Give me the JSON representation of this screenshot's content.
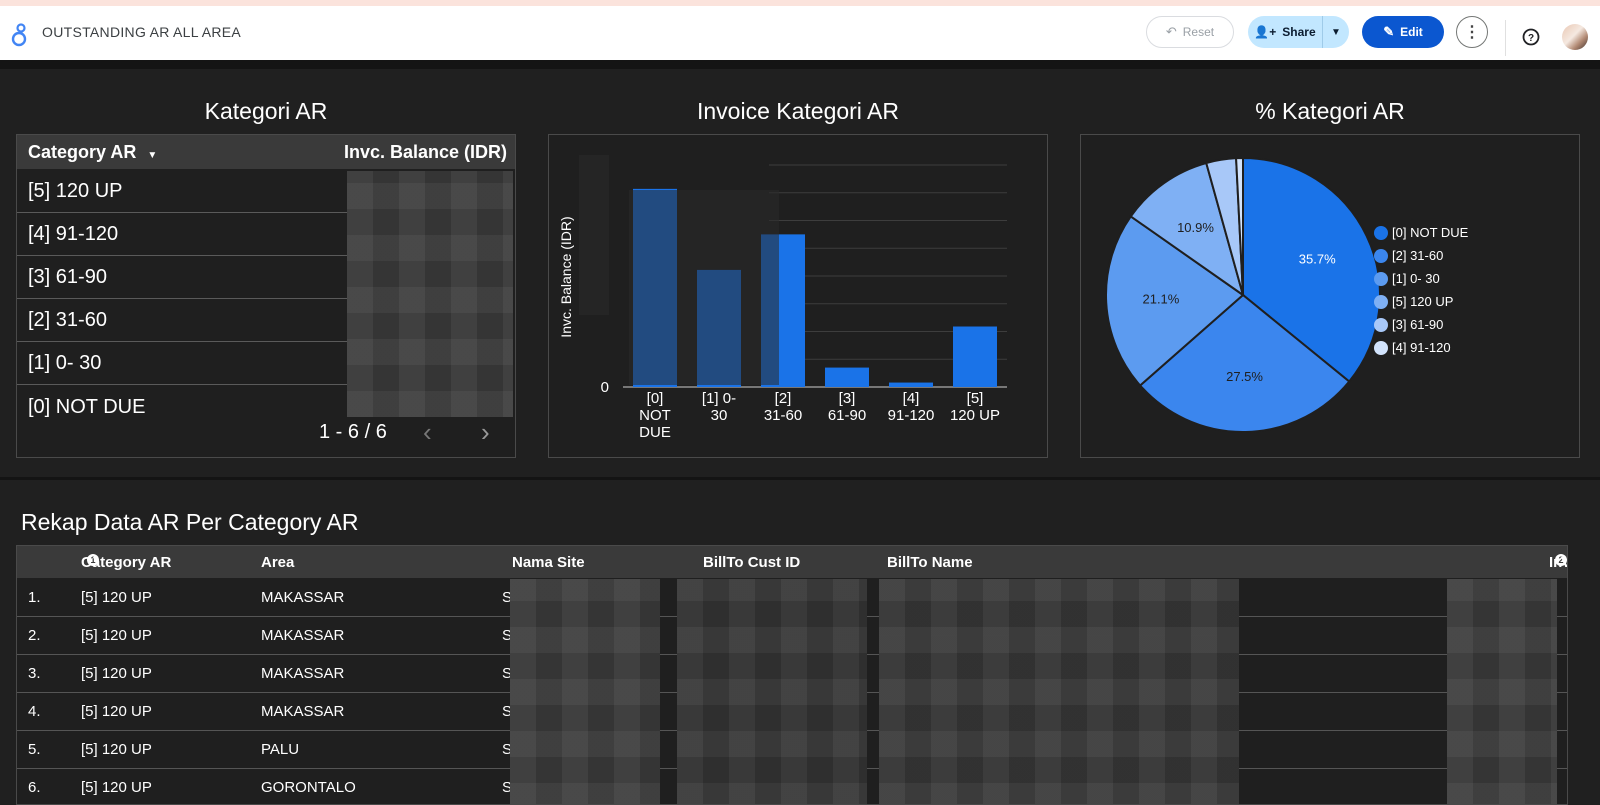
{
  "app": {
    "title": "OUTSTANDING AR ALL AREA",
    "reset_label": "Reset",
    "share_label": "Share",
    "edit_label": "Edit"
  },
  "kategori_table": {
    "title": "Kategori AR",
    "col_category": "Category AR",
    "col_balance": "Invc. Balance (IDR)",
    "rows": [
      "[5] 120 UP",
      "[4] 91-120",
      "[3] 61-90",
      "[2] 31-60",
      "[1] 0- 30",
      "[0] NOT DUE"
    ],
    "pagination": "1 - 6 / 6"
  },
  "chart_data": [
    {
      "type": "bar",
      "title": "Invoice Kategori AR",
      "ylabel": "Invc. Balance (IDR)",
      "xlabel": "",
      "categories": [
        "[0] NOT DUE",
        "[1] 0- 30",
        "[2] 31-60",
        "[3] 61-90",
        "[4] 91-120",
        "[5] 120 UP"
      ],
      "values": [
        35.7,
        21.1,
        27.5,
        3.5,
        0.8,
        10.9
      ],
      "y_tick_labels": [
        "0"
      ],
      "grid": true,
      "color": "#1a73e8"
    },
    {
      "type": "pie",
      "title": "% Kategori AR",
      "labels": [
        "[0] NOT DUE",
        "[2] 31-60",
        "[1] 0- 30",
        "[5] 120 UP",
        "[3] 61-90",
        "[4] 91-120"
      ],
      "values": [
        35.7,
        27.5,
        21.1,
        10.9,
        3.5,
        0.8
      ],
      "data_labels": [
        "35.7%",
        "27.5%",
        "21.1%",
        "10.9%",
        "",
        ""
      ],
      "colors": [
        "#1a73e8",
        "#3b86ee",
        "#5c9bf0",
        "#7fb0f4",
        "#a8c8f8",
        "#d2e3fc"
      ],
      "legend": "right"
    }
  ],
  "rekap": {
    "title": "Rekap Data AR Per Category AR",
    "headers": {
      "category": "Category AR",
      "area": "Area",
      "nama_site": "Nama Site",
      "billto_id": "BillTo Cust ID",
      "billto_name": "BillTo Name",
      "balance": "Invc. Balance (IDR)"
    },
    "rows": [
      {
        "no": "1.",
        "category": "[5] 120 UP",
        "area": "MAKASSAR",
        "site": "S"
      },
      {
        "no": "2.",
        "category": "[5] 120 UP",
        "area": "MAKASSAR",
        "site": "S"
      },
      {
        "no": "3.",
        "category": "[5] 120 UP",
        "area": "MAKASSAR",
        "site": "S"
      },
      {
        "no": "4.",
        "category": "[5] 120 UP",
        "area": "MAKASSAR",
        "site": "S"
      },
      {
        "no": "5.",
        "category": "[5] 120 UP",
        "area": "PALU",
        "site": "S"
      },
      {
        "no": "6.",
        "category": "[5] 120 UP",
        "area": "GORONTALO",
        "site": "S"
      }
    ]
  }
}
